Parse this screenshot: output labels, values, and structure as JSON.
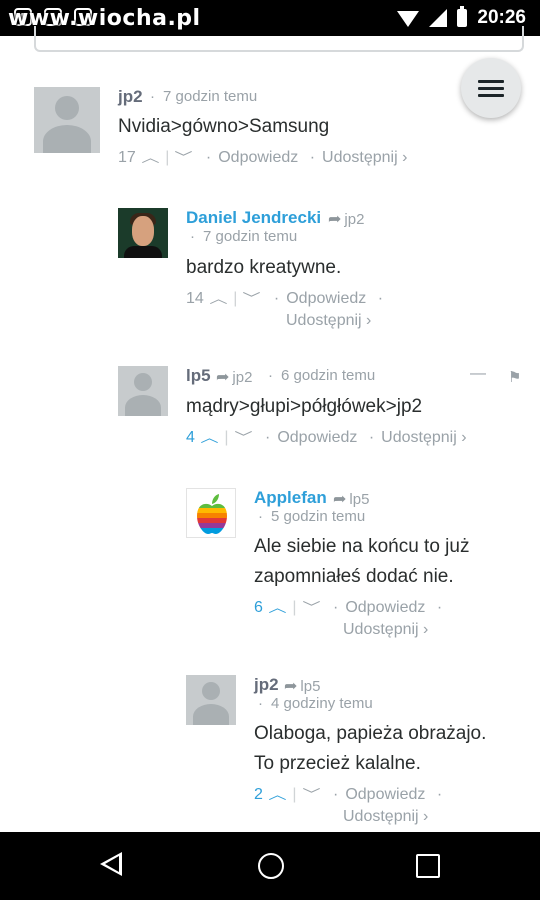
{
  "status_bar": {
    "time": "20:26",
    "watermark": "www.wiocha.pl"
  },
  "comments": [
    {
      "author": "jp2",
      "reply_to": "",
      "time": "7 godzin temu",
      "text": "Nvidia>gówno>Samsung",
      "votes": "17",
      "reply_label": "Odpowiedz",
      "share_label": "Udostępnij ›"
    },
    {
      "author": "Daniel Jendrecki",
      "reply_to": "jp2",
      "time": "7 godzin temu",
      "text": "bardzo kreatywne.",
      "votes": "14",
      "reply_label": "Odpowiedz",
      "share_label": "Udostępnij ›"
    },
    {
      "author": "lp5",
      "reply_to": "jp2",
      "time": "6 godzin temu",
      "text": "mądry>głupi>półgłówek>jp2",
      "votes": "4",
      "reply_label": "Odpowiedz",
      "share_label": "Udostępnij ›",
      "collapse": "—"
    },
    {
      "author": "Applefan",
      "reply_to": "lp5",
      "time": "5 godzin temu",
      "text_lines": [
        "Ale siebie na końcu to już",
        "zapomniałeś dodać nie."
      ],
      "votes": "6",
      "reply_label": "Odpowiedz",
      "share_label": "Udostępnij ›"
    },
    {
      "author": "jp2",
      "reply_to": "lp5",
      "time": "4 godziny temu",
      "text_lines": [
        "Olaboga, papieża obrażajo.",
        "To przecież kalalne."
      ],
      "votes": "2",
      "reply_label": "Odpowiedz",
      "share_label": "Udostępnij ›"
    }
  ],
  "colors": {
    "accent": "#2e9fd9",
    "muted": "#9aa2a8",
    "text": "#2a2e2e"
  }
}
